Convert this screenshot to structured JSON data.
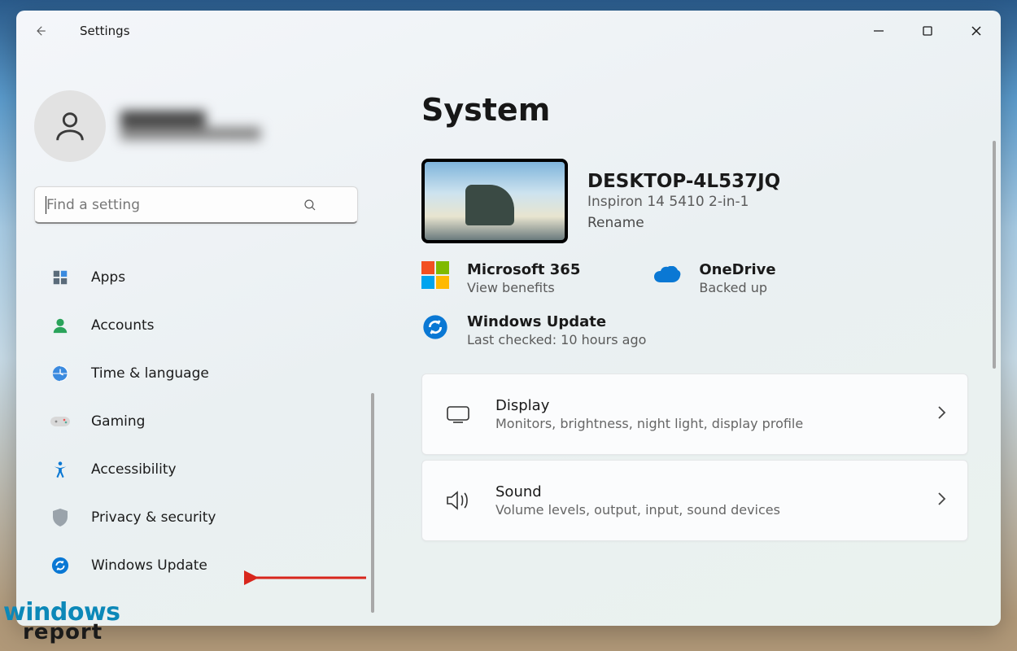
{
  "window": {
    "title": "Settings"
  },
  "search": {
    "placeholder": "Find a setting"
  },
  "sidebar": {
    "items": [
      {
        "label": "Apps"
      },
      {
        "label": "Accounts"
      },
      {
        "label": "Time & language"
      },
      {
        "label": "Gaming"
      },
      {
        "label": "Accessibility"
      },
      {
        "label": "Privacy & security"
      },
      {
        "label": "Windows Update"
      }
    ]
  },
  "main": {
    "title": "System",
    "device": {
      "name": "DESKTOP-4L537JQ",
      "model": "Inspiron 14 5410 2-in-1",
      "rename_label": "Rename"
    },
    "status": {
      "ms365": {
        "title": "Microsoft 365",
        "sub": "View benefits"
      },
      "onedrive": {
        "title": "OneDrive",
        "sub": "Backed up"
      },
      "winupdate": {
        "title": "Windows Update",
        "sub": "Last checked: 10 hours ago"
      }
    },
    "cards": [
      {
        "title": "Display",
        "sub": "Monitors, brightness, night light, display profile"
      },
      {
        "title": "Sound",
        "sub": "Volume levels, output, input, sound devices"
      }
    ]
  },
  "watermark": {
    "line1": "windows",
    "line2": "report"
  }
}
